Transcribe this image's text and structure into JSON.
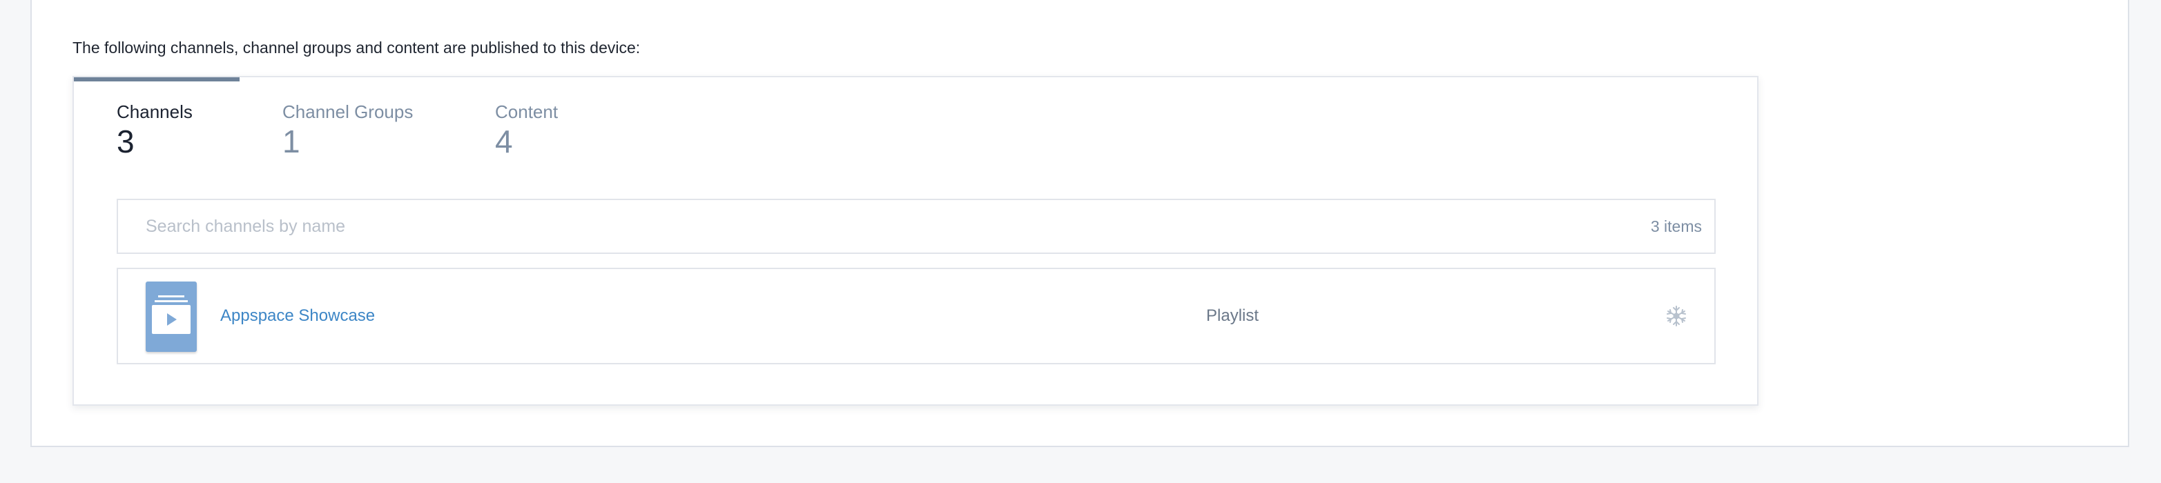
{
  "intro_text": "The following channels, channel groups and content are published to this device:",
  "tabs": [
    {
      "label": "Channels",
      "count": "3",
      "active": true
    },
    {
      "label": "Channel Groups",
      "count": "1",
      "active": false
    },
    {
      "label": "Content",
      "count": "4",
      "active": false
    }
  ],
  "search": {
    "placeholder": "Search channels by name",
    "value": "",
    "item_count": "3 items"
  },
  "channels": [
    {
      "name": "Appspace Showcase",
      "type": "Playlist",
      "thumbnail_icon": "play-icon",
      "action_icon": "snowflake-icon"
    }
  ],
  "colors": {
    "accent": "#3d86c6",
    "tab_indicator": "#6e8299",
    "thumbnail": "#7fa9d7",
    "muted_text": "#7d8ea3"
  }
}
